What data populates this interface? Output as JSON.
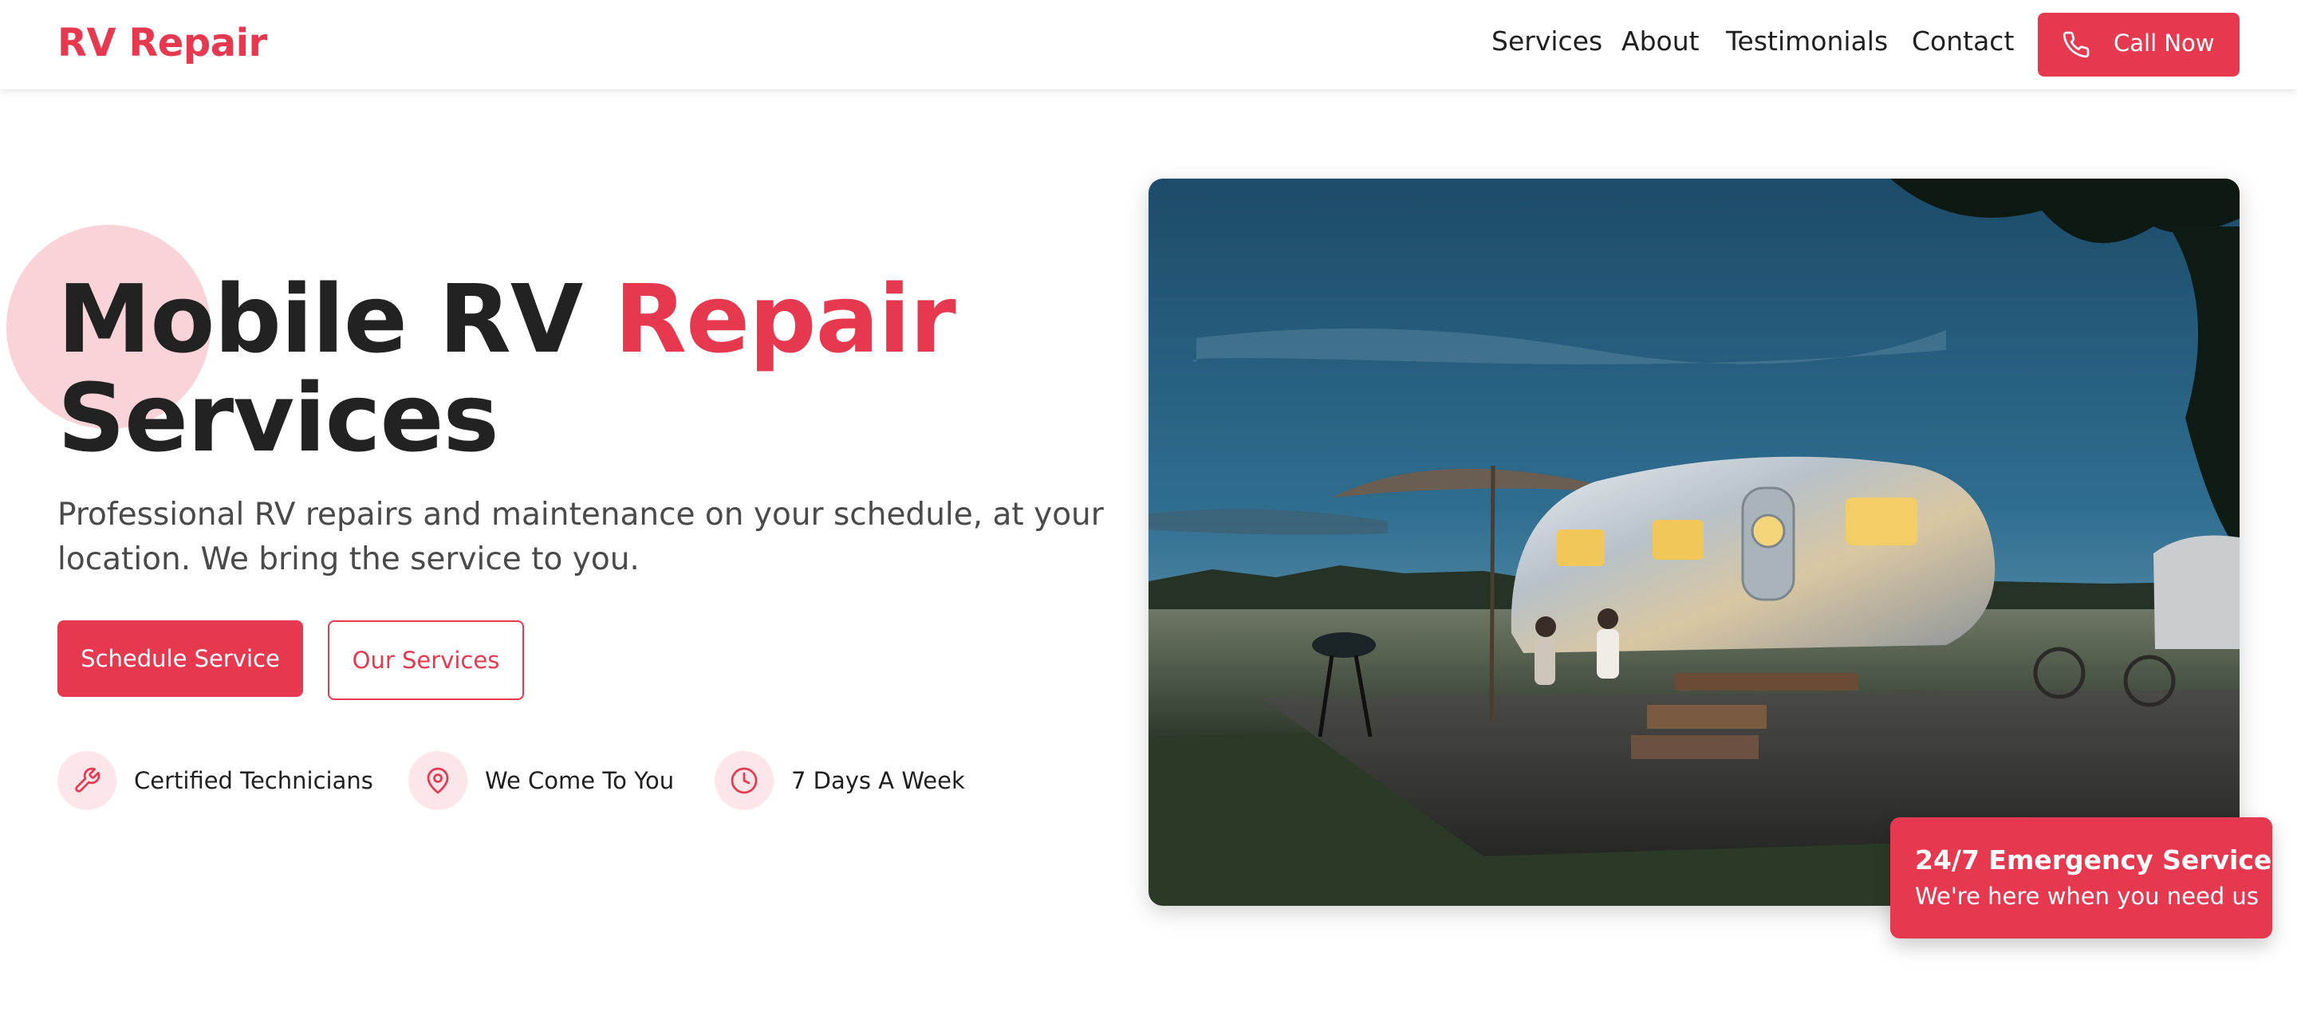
{
  "brand": {
    "logo": "RV Repair",
    "accent_color": "#e63950"
  },
  "nav": {
    "links": [
      "Services",
      "About",
      "Testimonials",
      "Contact"
    ],
    "cta_label": "Call Now",
    "cta_icon": "phone-icon"
  },
  "hero": {
    "title_part1": "Mobile RV ",
    "title_accent": "Repair",
    "title_part2": "Services",
    "subtitle": "Professional RV repairs and maintenance on your schedule, at your location. We bring the service to you.",
    "primary_button": "Schedule Service",
    "secondary_button": "Our Services",
    "features": [
      {
        "icon": "wrench-icon",
        "label": "Certified Technicians"
      },
      {
        "icon": "map-pin-icon",
        "label": "We Come To You"
      },
      {
        "icon": "clock-icon",
        "label": "7 Days A Week"
      }
    ]
  },
  "emergency": {
    "title": "24/7 Emergency Service",
    "subtitle": "We're here when you need us"
  }
}
